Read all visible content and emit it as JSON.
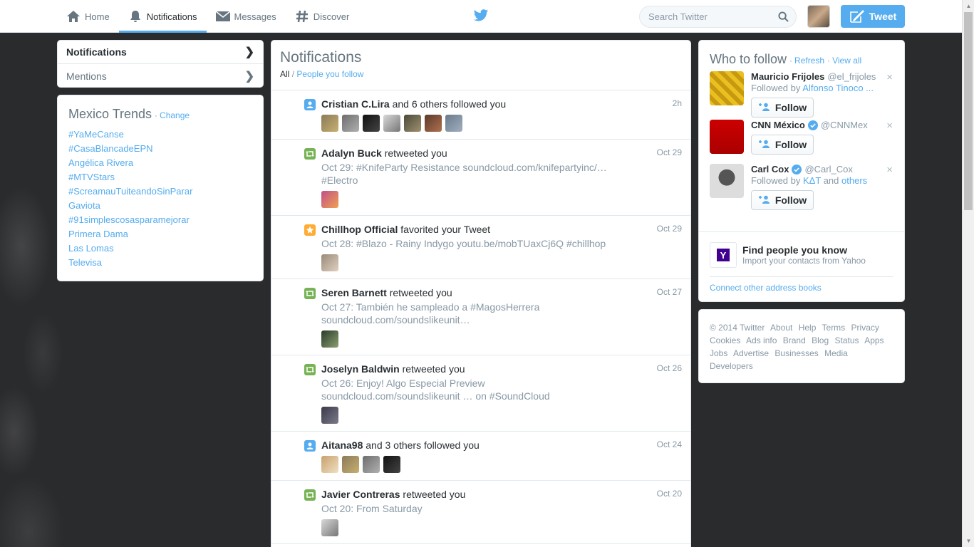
{
  "nav": {
    "home": "Home",
    "notifications": "Notifications",
    "messages": "Messages",
    "discover": "Discover"
  },
  "search": {
    "placeholder": "Search Twitter"
  },
  "tweet_button": "Tweet",
  "left_nav": {
    "notifications": "Notifications",
    "mentions": "Mentions"
  },
  "trends": {
    "title": "Mexico Trends",
    "change": "Change",
    "items": [
      "#YaMeCanse",
      "#CasaBlancadeEPN",
      "Angélica Rivera",
      "#MTVStars",
      "#ScreamauTuiteandoSinParar",
      "Gaviota",
      "#91simplescosasparamejorar",
      "Primera Dama",
      "Las Lomas",
      "Televisa"
    ]
  },
  "main": {
    "title": "Notifications",
    "filter_all": "All",
    "filter_sep": "/",
    "filter_people": "People you follow",
    "notifications": [
      {
        "type": "follow",
        "name": "Cristian C.Lira",
        "action": "and 6 others followed you",
        "time": "2h",
        "text": ""
      },
      {
        "type": "retweet",
        "name": "Adalyn Buck",
        "action": "retweeted you",
        "time": "Oct 29",
        "text": "Oct 29: #KnifeParty Resistance soundcloud.com/knifepartyinc/… #Electro"
      },
      {
        "type": "favorite",
        "name": "Chillhop Official",
        "action": "favorited your Tweet",
        "time": "Oct 29",
        "text": "Oct 28: #Blazo - Rainy Indygo youtu.be/mobTUaxCj6Q #chillhop"
      },
      {
        "type": "retweet",
        "name": "Seren Barnett",
        "action": "retweeted you",
        "time": "Oct 27",
        "text": "Oct 27: También he sampleado a #MagosHerrera soundcloud.com/soundslikeunit…"
      },
      {
        "type": "retweet",
        "name": "Joselyn Baldwin",
        "action": "retweeted you",
        "time": "Oct 26",
        "text": "Oct 26: Enjoy! Algo Especial Preview soundcloud.com/soundslikeunit … on #SoundCloud"
      },
      {
        "type": "follow",
        "name": "Aitana98",
        "action": "and 3 others followed you",
        "time": "Oct 24",
        "text": ""
      },
      {
        "type": "retweet",
        "name": "Javier Contreras",
        "action": "retweeted you",
        "time": "Oct 20",
        "text": "Oct 20: From Saturday"
      }
    ]
  },
  "who_to_follow": {
    "title": "Who to follow",
    "refresh": "Refresh",
    "view_all": "View all",
    "follow_label": "Follow",
    "dismiss": "×",
    "suggestions": [
      {
        "name": "Mauricio Frijoles",
        "handle": "@el_frijoles",
        "verified": false,
        "followed_by_prefix": "Followed by",
        "followed_by": "Alfonso Tinoco ...",
        "followed_by_suffix": "",
        "others": ""
      },
      {
        "name": "CNN México",
        "handle": "@CNNMex",
        "verified": true,
        "followed_by_prefix": "",
        "followed_by": "",
        "followed_by_suffix": "",
        "others": ""
      },
      {
        "name": "Carl Cox",
        "handle": "@Carl_Cox",
        "verified": true,
        "followed_by_prefix": "Followed by",
        "followed_by": "KΔT",
        "followed_by_suffix": "and",
        "others": "others"
      }
    ],
    "find_title": "Find people you know",
    "find_sub": "Import your contacts from Yahoo",
    "connect": "Connect other address books"
  },
  "footer": {
    "copyright": "© 2014 Twitter",
    "links": [
      "About",
      "Help",
      "Terms",
      "Privacy",
      "Cookies",
      "Ads info",
      "Brand",
      "Blog",
      "Status",
      "Apps",
      "Jobs",
      "Advertise",
      "Businesses",
      "Media",
      "Developers"
    ]
  },
  "colors": {
    "accent": "#55acee",
    "retweet": "#77b255",
    "favorite": "#ffac33",
    "background": "#2b2c2e"
  }
}
